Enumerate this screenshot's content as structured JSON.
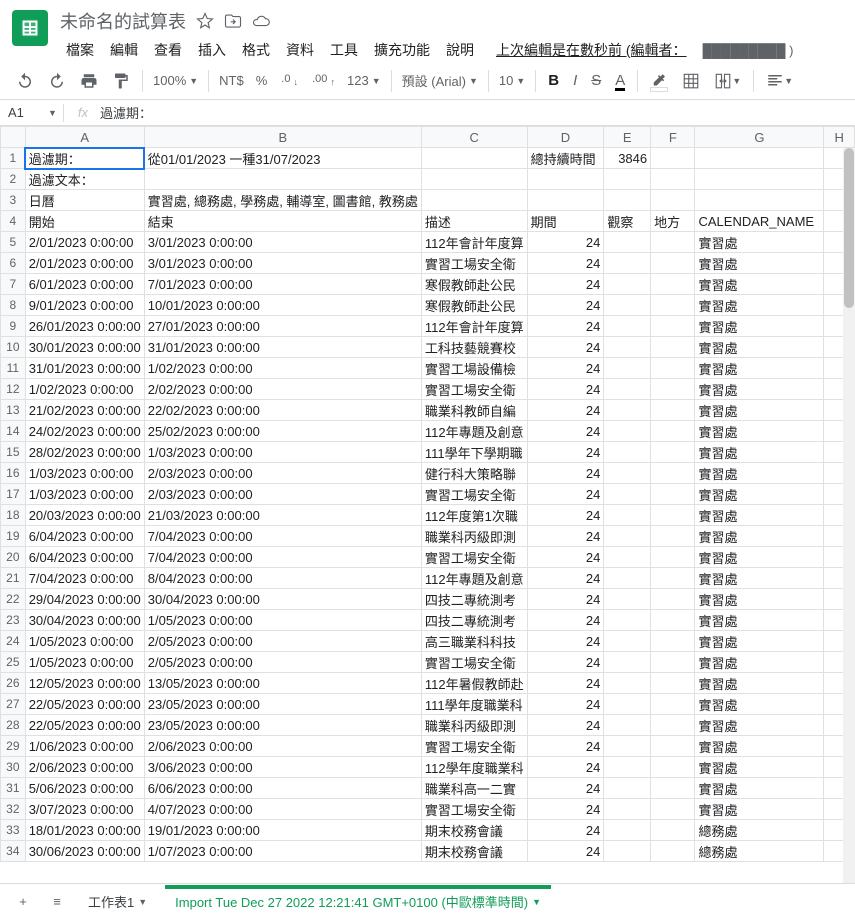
{
  "doc": {
    "title": "未命名的試算表"
  },
  "menubar": [
    "檔案",
    "編輯",
    "查看",
    "插入",
    "格式",
    "資料",
    "工具",
    "擴充功能",
    "說明"
  ],
  "last_edit": "上次編輯是在數秒前 (編輯者：",
  "toolbar": {
    "zoom": "100%",
    "currency": "NT$",
    "percent": "%",
    "dec_dec": ".0",
    "dec_inc": ".00",
    "numfmt": "123",
    "font": "預設 (Arial)",
    "fsize": "10",
    "bold": "B",
    "italic": "I",
    "strike": "S",
    "tcolor": "A"
  },
  "namebox": "A1",
  "formula": "過濾期：",
  "columns": [
    "A",
    "B",
    "C",
    "D",
    "E",
    "F",
    "G",
    "H"
  ],
  "tabs": {
    "t1": "工作表1",
    "t2": "Import Tue Dec 27 2022 12:21:41 GMT+0100 (中歐標準時間)"
  },
  "rows": [
    {
      "n": 1,
      "a": "過濾期：",
      "b": "從01/01/2023 一種31/07/2023",
      "d": "總持續時間",
      "e": "3846"
    },
    {
      "n": 2,
      "a": "過濾文本："
    },
    {
      "n": 3,
      "a": "日曆",
      "b": "實習處, 總務處, 學務處, 輔導室, 圖書館, 教務處"
    },
    {
      "n": 4,
      "a": "開始",
      "b": "結束",
      "c": "描述",
      "d": "期間",
      "e": "觀察",
      "f": "地方",
      "g": "CALENDAR_NAME"
    },
    {
      "n": 5,
      "a": "2/01/2023 0:00:00",
      "b": "3/01/2023 0:00:00",
      "c": "112年會計年度算",
      "d": "24",
      "g": "實習處"
    },
    {
      "n": 6,
      "a": "2/01/2023 0:00:00",
      "b": "3/01/2023 0:00:00",
      "c": "實習工場安全衛",
      "d": "24",
      "g": "實習處"
    },
    {
      "n": 7,
      "a": "6/01/2023 0:00:00",
      "b": "7/01/2023 0:00:00",
      "c": "寒假教師赴公民",
      "d": "24",
      "g": "實習處"
    },
    {
      "n": 8,
      "a": "9/01/2023 0:00:00",
      "b": "10/01/2023 0:00:00",
      "c": "寒假教師赴公民",
      "d": "24",
      "g": "實習處"
    },
    {
      "n": 9,
      "a": "26/01/2023 0:00:00",
      "b": "27/01/2023 0:00:00",
      "c": "112年會計年度算",
      "d": "24",
      "g": "實習處"
    },
    {
      "n": 10,
      "a": "30/01/2023 0:00:00",
      "b": "31/01/2023 0:00:00",
      "c": "工科技藝競賽校",
      "d": "24",
      "g": "實習處"
    },
    {
      "n": 11,
      "a": "31/01/2023 0:00:00",
      "b": "1/02/2023 0:00:00",
      "c": "實習工場設備檢",
      "d": "24",
      "g": "實習處"
    },
    {
      "n": 12,
      "a": "1/02/2023 0:00:00",
      "b": "2/02/2023 0:00:00",
      "c": "實習工場安全衛",
      "d": "24",
      "g": "實習處"
    },
    {
      "n": 13,
      "a": "21/02/2023 0:00:00",
      "b": "22/02/2023 0:00:00",
      "c": "職業科教師自編",
      "d": "24",
      "g": "實習處"
    },
    {
      "n": 14,
      "a": "24/02/2023 0:00:00",
      "b": "25/02/2023 0:00:00",
      "c": "112年專題及創意",
      "d": "24",
      "g": "實習處"
    },
    {
      "n": 15,
      "a": "28/02/2023 0:00:00",
      "b": "1/03/2023 0:00:00",
      "c": "111學年下學期職",
      "d": "24",
      "g": "實習處"
    },
    {
      "n": 16,
      "a": "1/03/2023 0:00:00",
      "b": "2/03/2023 0:00:00",
      "c": "健行科大策略聯",
      "d": "24",
      "g": "實習處"
    },
    {
      "n": 17,
      "a": "1/03/2023 0:00:00",
      "b": "2/03/2023 0:00:00",
      "c": "實習工場安全衛",
      "d": "24",
      "g": "實習處"
    },
    {
      "n": 18,
      "a": "20/03/2023 0:00:00",
      "b": "21/03/2023 0:00:00",
      "c": "112年度第1次職",
      "d": "24",
      "g": "實習處"
    },
    {
      "n": 19,
      "a": "6/04/2023 0:00:00",
      "b": "7/04/2023 0:00:00",
      "c": "職業科丙級即測",
      "d": "24",
      "g": "實習處"
    },
    {
      "n": 20,
      "a": "6/04/2023 0:00:00",
      "b": "7/04/2023 0:00:00",
      "c": "實習工場安全衛",
      "d": "24",
      "g": "實習處"
    },
    {
      "n": 21,
      "a": "7/04/2023 0:00:00",
      "b": "8/04/2023 0:00:00",
      "c": "112年專題及創意",
      "d": "24",
      "g": "實習處"
    },
    {
      "n": 22,
      "a": "29/04/2023 0:00:00",
      "b": "30/04/2023 0:00:00",
      "c": "四技二專統測考",
      "d": "24",
      "g": "實習處"
    },
    {
      "n": 23,
      "a": "30/04/2023 0:00:00",
      "b": "1/05/2023 0:00:00",
      "c": "四技二專統測考",
      "d": "24",
      "g": "實習處"
    },
    {
      "n": 24,
      "a": "1/05/2023 0:00:00",
      "b": "2/05/2023 0:00:00",
      "c": "高三職業科科技",
      "d": "24",
      "g": "實習處"
    },
    {
      "n": 25,
      "a": "1/05/2023 0:00:00",
      "b": "2/05/2023 0:00:00",
      "c": "實習工場安全衛",
      "d": "24",
      "g": "實習處"
    },
    {
      "n": 26,
      "a": "12/05/2023 0:00:00",
      "b": "13/05/2023 0:00:00",
      "c": "112年暑假教師赴",
      "d": "24",
      "g": "實習處"
    },
    {
      "n": 27,
      "a": "22/05/2023 0:00:00",
      "b": "23/05/2023 0:00:00",
      "c": "111學年度職業科",
      "d": "24",
      "g": "實習處"
    },
    {
      "n": 28,
      "a": "22/05/2023 0:00:00",
      "b": "23/05/2023 0:00:00",
      "c": "職業科丙級即測",
      "d": "24",
      "g": "實習處"
    },
    {
      "n": 29,
      "a": "1/06/2023 0:00:00",
      "b": "2/06/2023 0:00:00",
      "c": "實習工場安全衛",
      "d": "24",
      "g": "實習處"
    },
    {
      "n": 30,
      "a": "2/06/2023 0:00:00",
      "b": "3/06/2023 0:00:00",
      "c": "112學年度職業科",
      "d": "24",
      "g": "實習處"
    },
    {
      "n": 31,
      "a": "5/06/2023 0:00:00",
      "b": "6/06/2023 0:00:00",
      "c": "職業科高一二實",
      "d": "24",
      "g": "實習處"
    },
    {
      "n": 32,
      "a": "3/07/2023 0:00:00",
      "b": "4/07/2023 0:00:00",
      "c": "實習工場安全衛",
      "d": "24",
      "g": "實習處"
    },
    {
      "n": 33,
      "a": "18/01/2023 0:00:00",
      "b": "19/01/2023 0:00:00",
      "c": "期末校務會議",
      "d": "24",
      "g": "總務處"
    },
    {
      "n": 34,
      "a": "30/06/2023 0:00:00",
      "b": "1/07/2023 0:00:00",
      "c": "期末校務會議",
      "d": "24",
      "g": "總務處"
    }
  ]
}
